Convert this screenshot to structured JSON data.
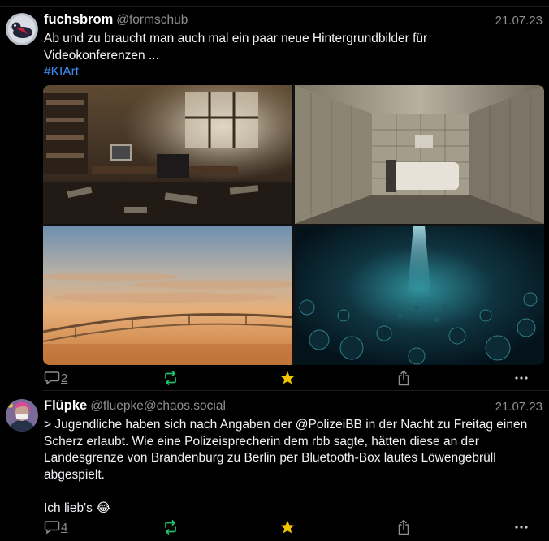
{
  "posts": [
    {
      "author": "fuchsbrom",
      "handle": "@formschub",
      "date": "21.07.23",
      "text_lines": [
        "Ab und zu braucht man auch mal ein paar neue Hintergrundbilder für",
        "Videokonferenzen ..."
      ],
      "hashtag": "#KIArt",
      "images": [
        "messy-office-image",
        "padded-cell-image",
        "sunset-sky-image",
        "underwater-cave-image"
      ],
      "reply_count": "2",
      "favorited": true
    },
    {
      "author": "Flüpke",
      "handle": "@fluepke@chaos.social",
      "date": "21.07.23",
      "text_lines": [
        "> Jugendliche haben sich nach Angaben der @PolizeiBB  in der Nacht zu Freitag einen",
        "Scherz erlaubt. Wie eine Polizeisprecherin dem rbb sagte, hätten diese an der",
        "Landesgrenze von Brandenburg zu Berlin per Bluetooth-Box lautes Löwengebrüll",
        "abgespielt.",
        "",
        "Ich lieb's 😂"
      ],
      "reply_count": "4",
      "favorited": true
    }
  ],
  "icons": {
    "reply": "speech-bubble-icon",
    "boost": "repost-arrows-icon",
    "favorite": "star-icon",
    "share": "share-icon",
    "more": "ellipsis-icon"
  },
  "colors": {
    "background": "#000000",
    "text": "#f2f2f7",
    "secondary": "#8e8e93",
    "hashtag": "#3d8bf2",
    "boost": "#1fbf6b",
    "favorite": "#f5c400"
  }
}
